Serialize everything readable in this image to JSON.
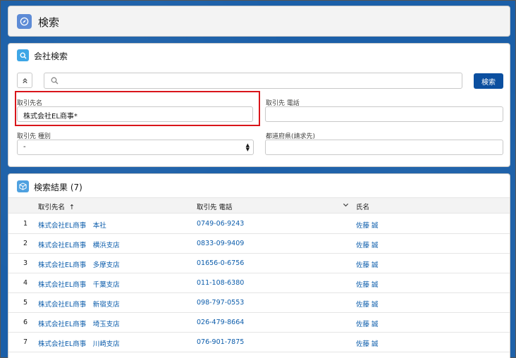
{
  "header": {
    "title": "検索",
    "icon": "compass-icon"
  },
  "search": {
    "title": "会社検索",
    "icon": "search-icon",
    "placeholder": "",
    "button_label": "検索",
    "fields": {
      "account_name": {
        "label": "取引先名",
        "value": "株式会社EL商事*"
      },
      "account_phone": {
        "label": "取引先 電話",
        "value": ""
      },
      "account_type": {
        "label": "取引先 種別",
        "value": "-"
      },
      "prefecture": {
        "label": "都道府県(請求先)",
        "value": ""
      }
    }
  },
  "results": {
    "title": "検索結果 (7)",
    "icon": "cube-icon",
    "columns": {
      "name": "取引先名",
      "phone": "取引先 電話",
      "owner": "氏名"
    },
    "sort_indicator": "↑",
    "rows": [
      {
        "num": "1",
        "name": "株式会社EL商事　本社",
        "phone": "0749-06-9243",
        "owner": "佐藤 誠"
      },
      {
        "num": "2",
        "name": "株式会社EL商事　横浜支店",
        "phone": "0833-09-9409",
        "owner": "佐藤 誠"
      },
      {
        "num": "3",
        "name": "株式会社EL商事　多摩支店",
        "phone": "01656-0-6756",
        "owner": "佐藤 誠"
      },
      {
        "num": "4",
        "name": "株式会社EL商事　千葉支店",
        "phone": "011-108-6380",
        "owner": "佐藤 誠"
      },
      {
        "num": "5",
        "name": "株式会社EL商事　新宿支店",
        "phone": "098-797-0553",
        "owner": "佐藤 誠"
      },
      {
        "num": "6",
        "name": "株式会社EL商事　埼玉支店",
        "phone": "026-479-8664",
        "owner": "佐藤 誠"
      },
      {
        "num": "7",
        "name": "株式会社EL商事　川崎支店",
        "phone": "076-901-7875",
        "owner": "佐藤 誠"
      }
    ]
  },
  "colors": {
    "brand": "#0b4fa0",
    "link": "#0b5cab",
    "highlight": "#d9151a"
  }
}
